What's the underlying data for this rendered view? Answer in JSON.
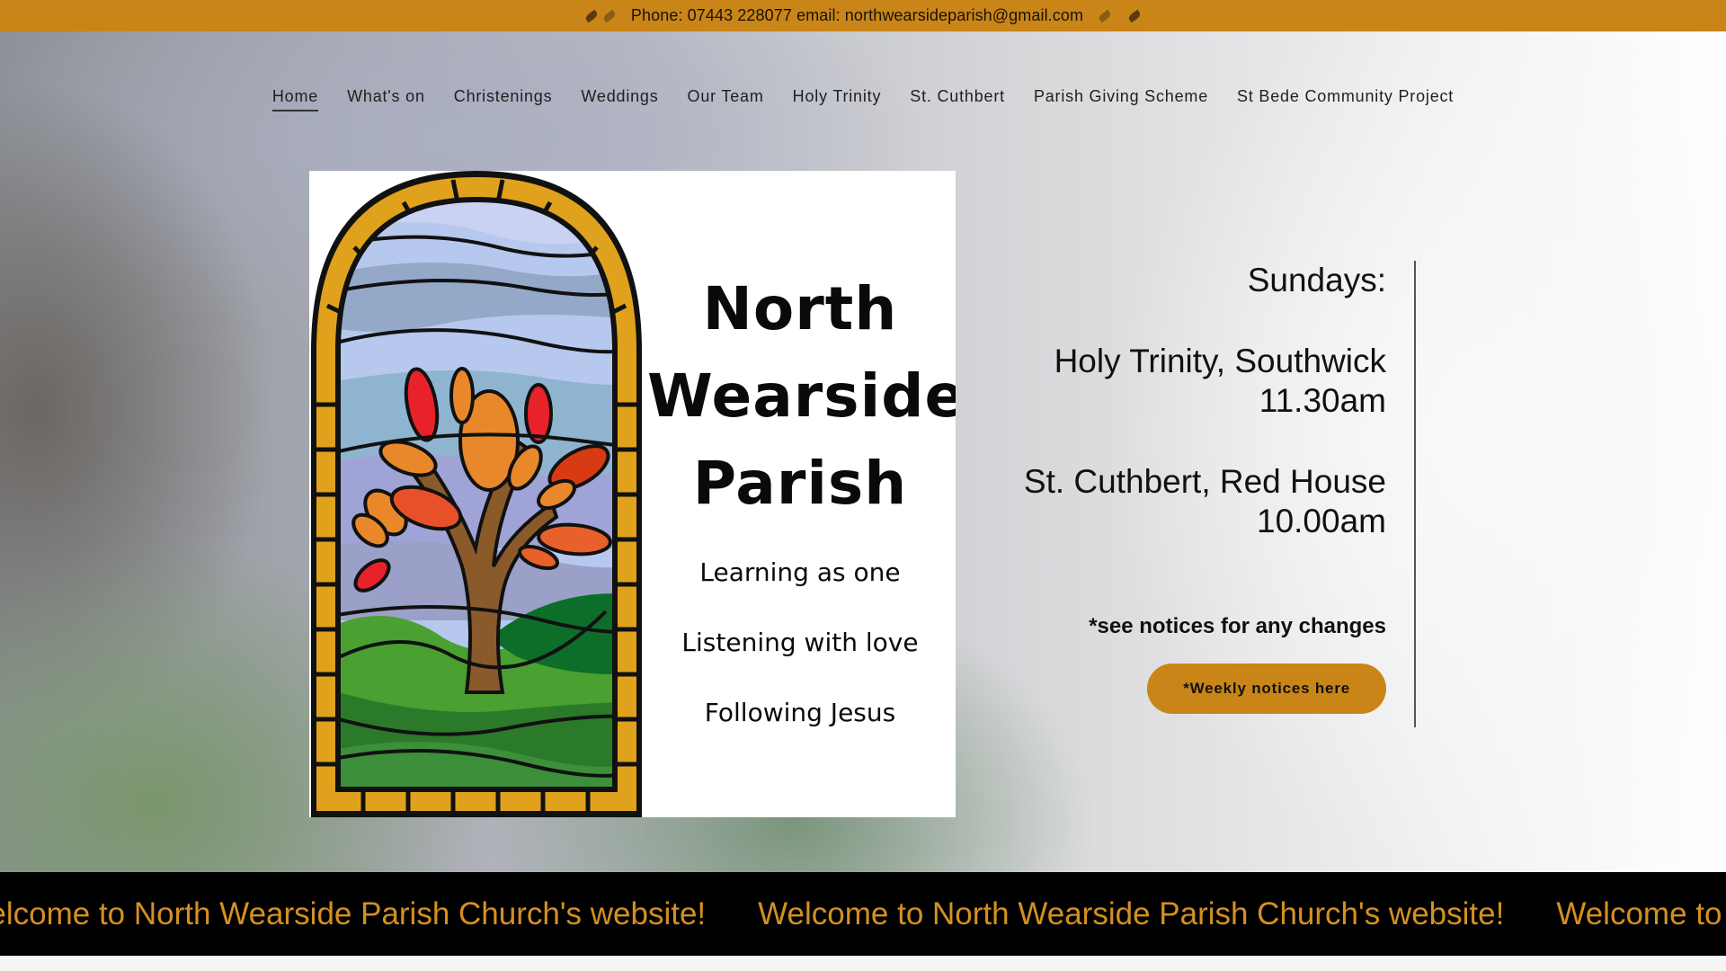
{
  "topbar": {
    "contact": "Phone: 07443 228077 email: northwearsideparish@gmail.com",
    "left_icon": "leaves-icon",
    "right_icon": "leaves-icon"
  },
  "nav": {
    "items": [
      {
        "label": "Home",
        "active": true
      },
      {
        "label": "What's on"
      },
      {
        "label": "Christenings"
      },
      {
        "label": "Weddings"
      },
      {
        "label": "Our Team"
      },
      {
        "label": "Holy Trinity"
      },
      {
        "label": "St. Cuthbert"
      },
      {
        "label": "Parish Giving Scheme"
      },
      {
        "label": "St Bede Community Project"
      }
    ]
  },
  "logo": {
    "title_line1": "North",
    "title_line2": "Wearside",
    "title_line3": "Parish",
    "tagline1": "Learning as one",
    "tagline2": "Listening with love",
    "tagline3": "Following Jesus",
    "image_icon": "stained-glass-tree-window"
  },
  "services": {
    "heading": "Sundays:",
    "church1_name": "Holy Trinity, Southwick",
    "church1_time": "11.30am",
    "church2_name": "St. Cuthbert, Red House",
    "church2_time": "10.00am",
    "note": "*see notices for any changes",
    "button_label": "*Weekly notices here"
  },
  "marquee": {
    "text": "Welcome to North Wearside Parish Church's website!"
  },
  "colors": {
    "accent": "#c98518",
    "marquee_text": "#d4901f",
    "marquee_bg": "#000000"
  }
}
